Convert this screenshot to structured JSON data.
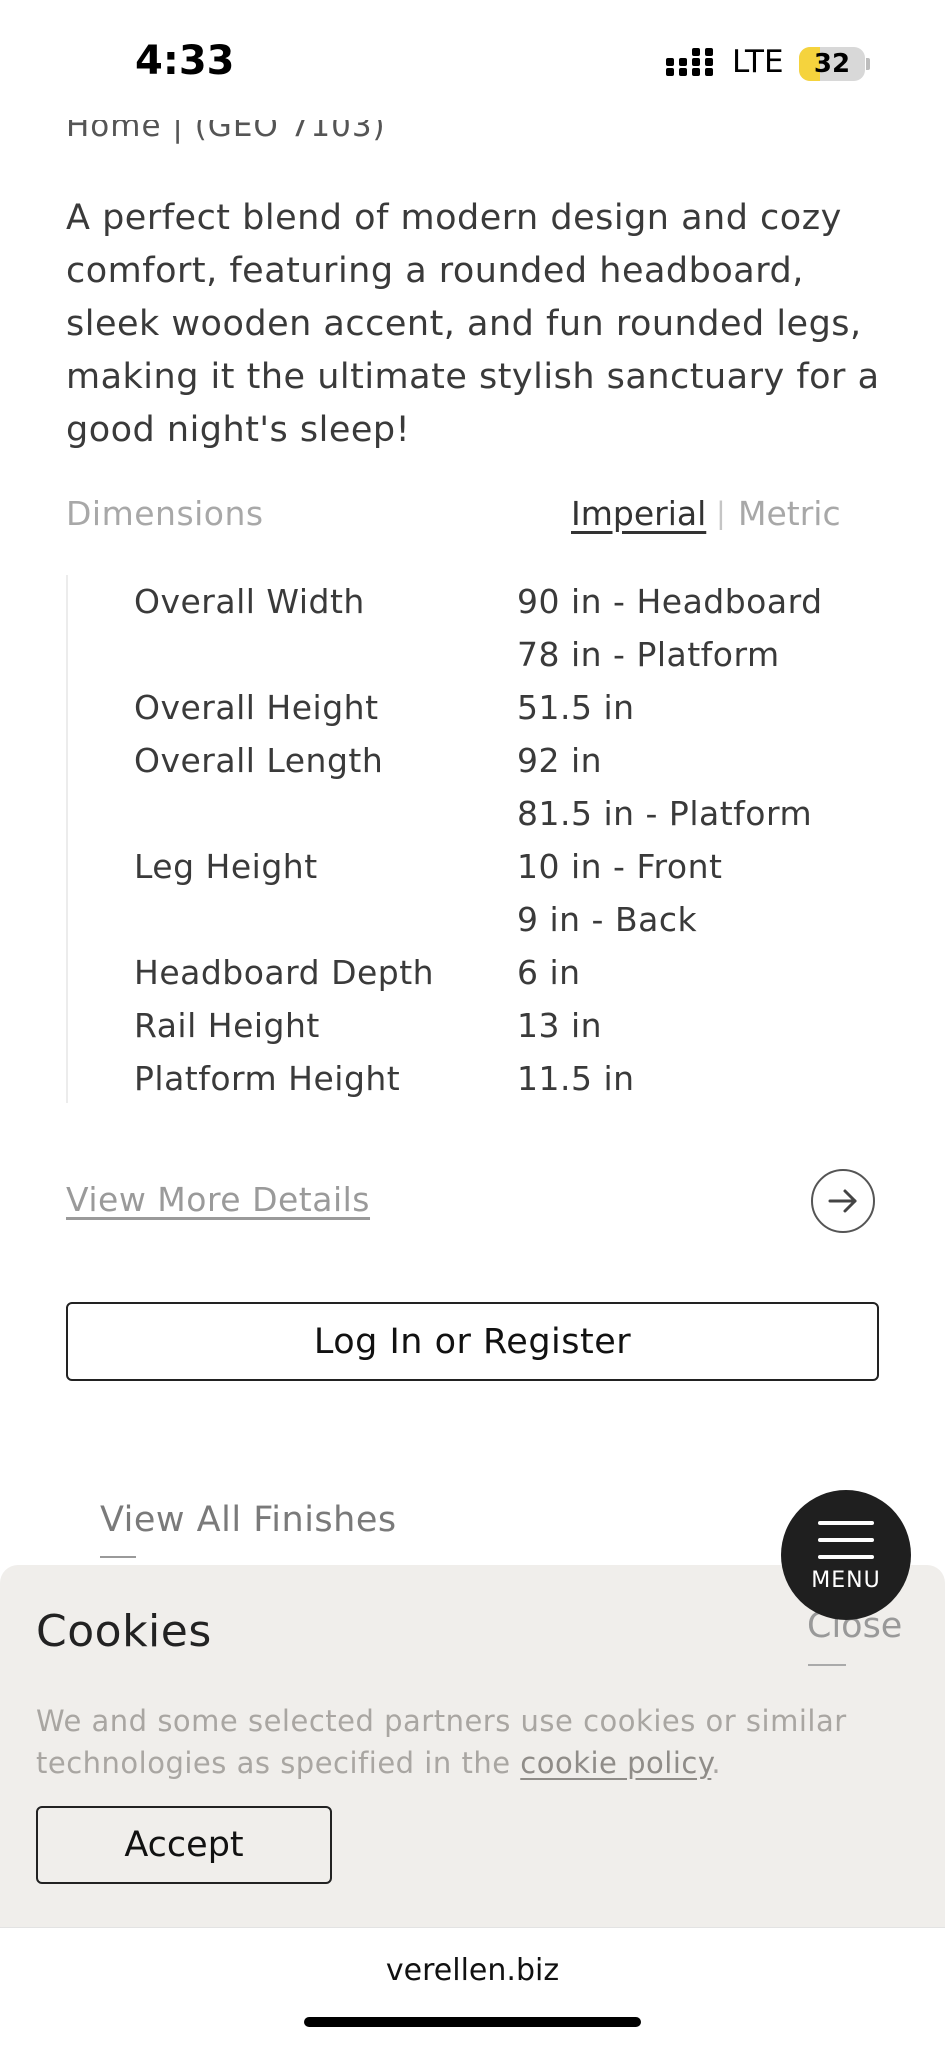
{
  "status_bar": {
    "time": "4:33",
    "network": "LTE",
    "battery_level": "32",
    "battery_fraction": 0.32
  },
  "product": {
    "breadcrumb": "Home | (GEO 7103)",
    "description": "A perfect blend of modern design and cozy comfort, featuring a rounded headboard, sleek wooden accent, and fun rounded legs, making it the ultimate stylish sanctuary for a good night's sleep!"
  },
  "dimensions": {
    "label": "Dimensions",
    "unit_imperial": "Imperial",
    "unit_separator": "|",
    "unit_metric": "Metric",
    "selected_unit": "Imperial",
    "rows": [
      {
        "name": "Overall Width",
        "values": [
          "90 in - Headboard",
          "78 in - Platform"
        ]
      },
      {
        "name": "Overall Height",
        "values": [
          "51.5 in"
        ]
      },
      {
        "name": "Overall Length",
        "values": [
          "92 in",
          "81.5 in - Platform"
        ]
      },
      {
        "name": "Leg Height",
        "values": [
          "10 in - Front",
          "9 in - Back"
        ]
      },
      {
        "name": "Headboard Depth",
        "values": [
          "6 in"
        ]
      },
      {
        "name": "Rail Height",
        "values": [
          "13 in"
        ]
      },
      {
        "name": "Platform Height",
        "values": [
          "11.5 in"
        ]
      }
    ]
  },
  "actions": {
    "view_more": "View More Details",
    "login": "Log In or Register",
    "view_finishes": "View All Finishes"
  },
  "menu": {
    "label": "MENU"
  },
  "cookie_banner": {
    "title": "Cookies",
    "close": "Close",
    "text_before_link": "We and some selected partners use cookies or similar technologies as specified in the ",
    "link_text": "cookie policy",
    "text_after_link": ".",
    "accept": "Accept"
  },
  "browser": {
    "url": "verellen.biz"
  },
  "icons": {
    "signal": "cellular-signal-icon",
    "arrow": "arrow-right-icon",
    "menu": "hamburger-icon"
  }
}
